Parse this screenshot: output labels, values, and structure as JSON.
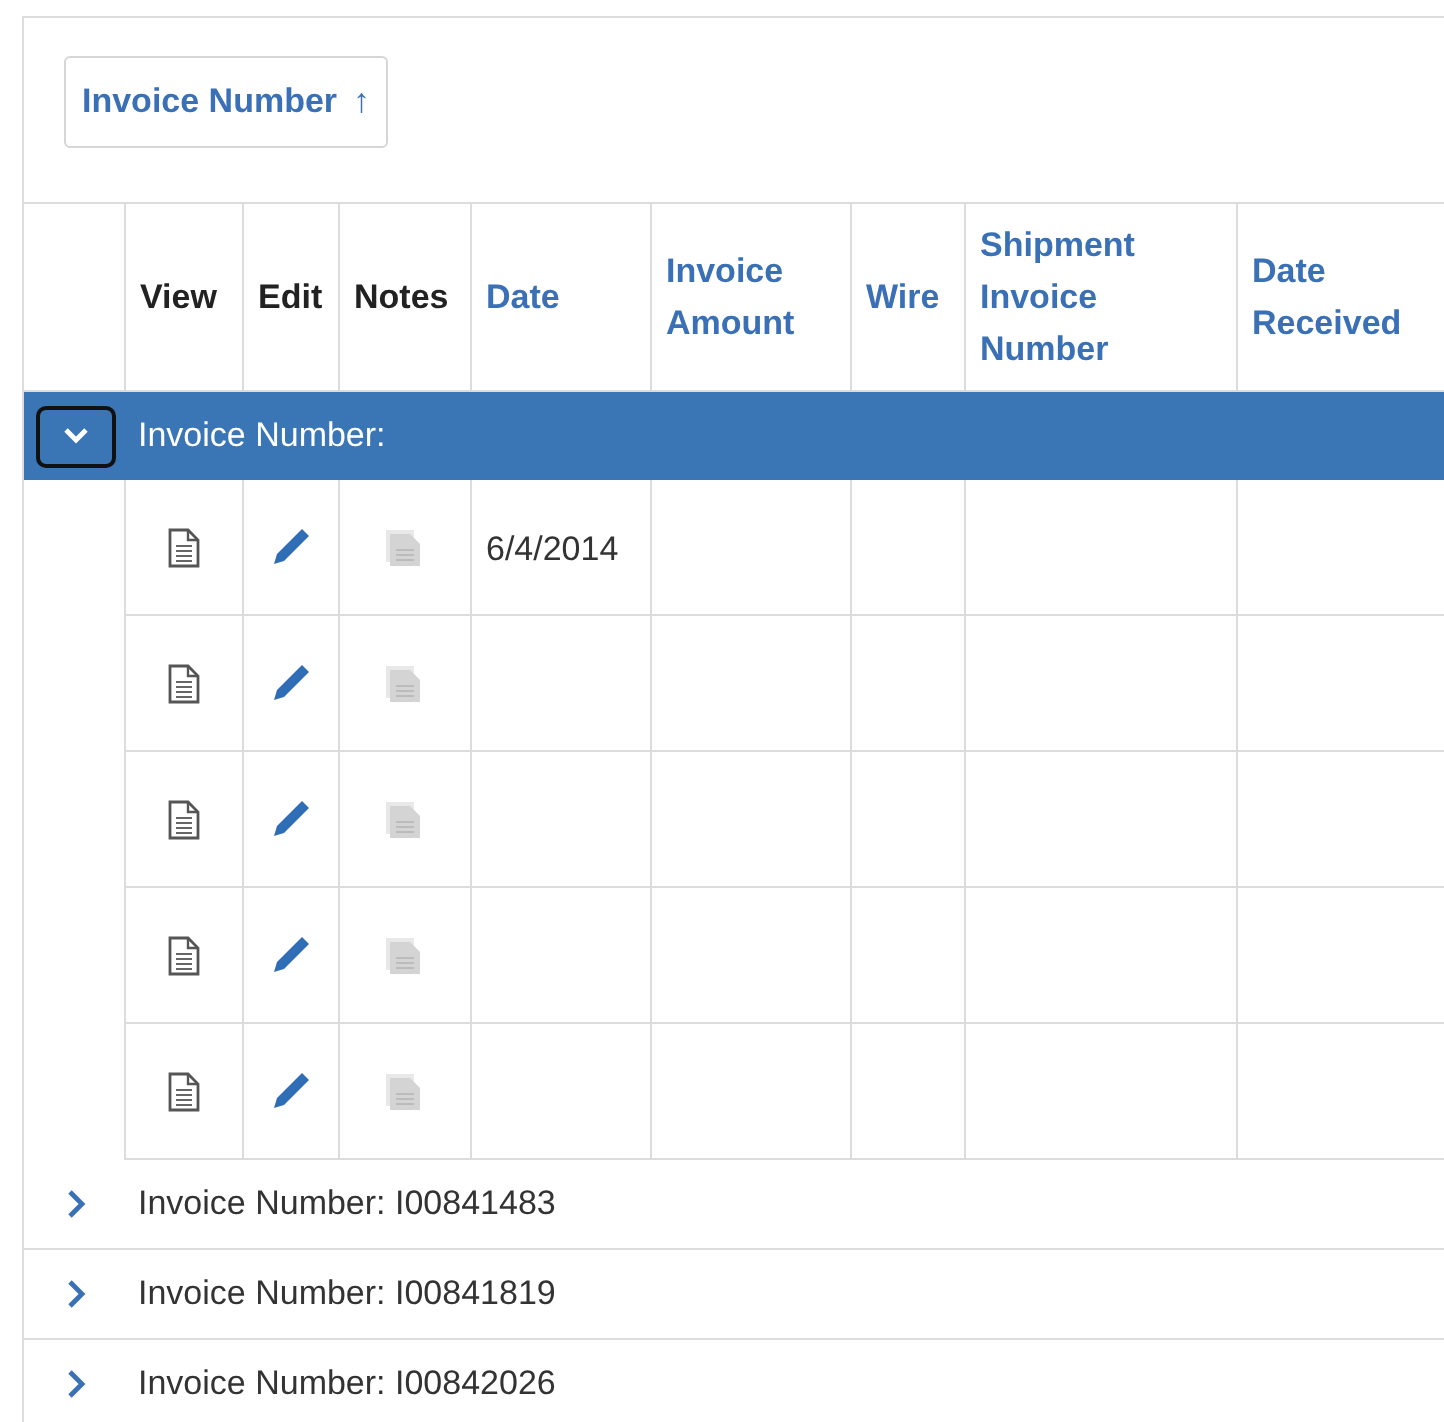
{
  "sort_button": {
    "label": "Invoice Number",
    "icon": "↑"
  },
  "columns": [
    {
      "label": "View",
      "kind": "plain"
    },
    {
      "label": "Edit",
      "kind": "plain"
    },
    {
      "label": "Notes",
      "kind": "plain"
    },
    {
      "label": "Date",
      "kind": "sortable"
    },
    {
      "label": "Invoice Amount",
      "kind": "sortable"
    },
    {
      "label": "Wire",
      "kind": "sortable"
    },
    {
      "label": "Shipment Invoice Number",
      "kind": "sortable"
    },
    {
      "label": "Date Received",
      "kind": "sortable"
    }
  ],
  "groups": [
    {
      "label": "Invoice Number:",
      "expanded": true,
      "selected": true,
      "rows": [
        {
          "date": "6/4/2014",
          "notes_enabled": false
        },
        {
          "notes_enabled": false
        },
        {
          "notes_enabled": false
        },
        {
          "notes_enabled": false
        },
        {
          "notes_enabled": false
        }
      ]
    },
    {
      "label": "Invoice Number: I00841483",
      "expanded": false,
      "selected": false
    },
    {
      "label": "Invoice Number: I00841819",
      "expanded": false,
      "selected": false
    },
    {
      "label": "Invoice Number: I00842026",
      "expanded": false,
      "selected": false
    }
  ]
}
